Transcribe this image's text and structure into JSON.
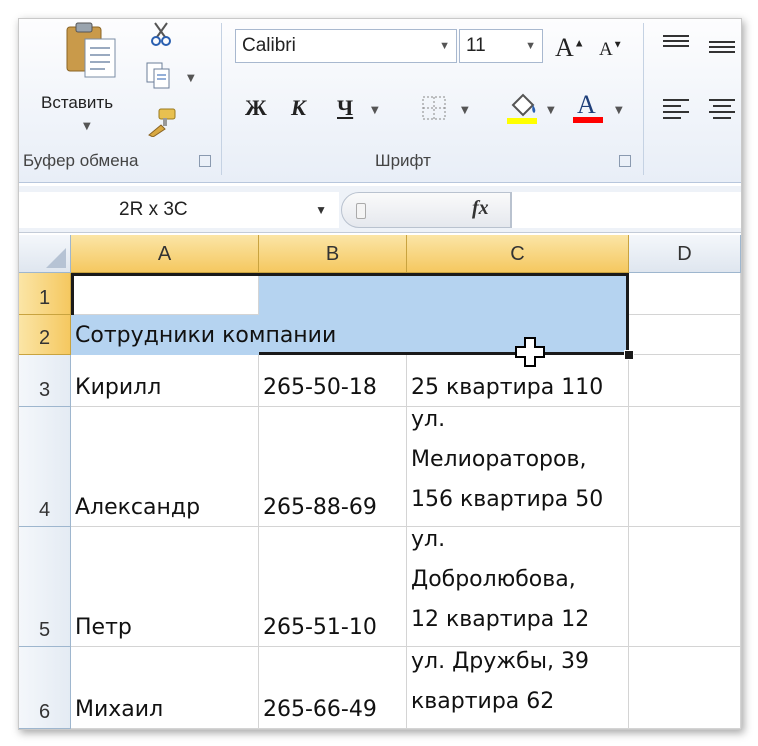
{
  "ribbon": {
    "clipboard": {
      "paste_label": "Вставить",
      "group_label": "Буфер обмена"
    },
    "font": {
      "font_name": "Calibri",
      "font_size": "11",
      "bold_label": "Ж",
      "italic_label": "К",
      "underline_label": "Ч",
      "grow_label": "A",
      "shrink_label": "A",
      "font_color_label": "A",
      "group_label": "Шрифт",
      "fill_color": "#ffff00",
      "font_color": "#ff0000"
    }
  },
  "formula_bar": {
    "name_box": "2R x 3C",
    "fx_label": "fx",
    "value": ""
  },
  "sheet": {
    "columns": [
      "A",
      "B",
      "C",
      "D"
    ],
    "rows": [
      "1",
      "2",
      "3",
      "4",
      "5",
      "6"
    ],
    "cells": {
      "a2": "Сотрудники компании",
      "a3": "Кирилл",
      "b3": "265-50-18",
      "c3": "25 квартира 110",
      "a4": "Александр",
      "b4": "265-88-69",
      "c4": "ул.\nМелиораторов,\n156 квартира 50",
      "a5": "Петр",
      "b5": "265-51-10",
      "c5": "ул.\nДобролюбова,\n12 квартира 12",
      "a6": "Михаил",
      "b6": "265-66-49",
      "c6": "ул. Дружбы, 39\nквартира 62"
    },
    "selection_color": "#b5d3f0",
    "header_highlight": "#f5c860"
  }
}
